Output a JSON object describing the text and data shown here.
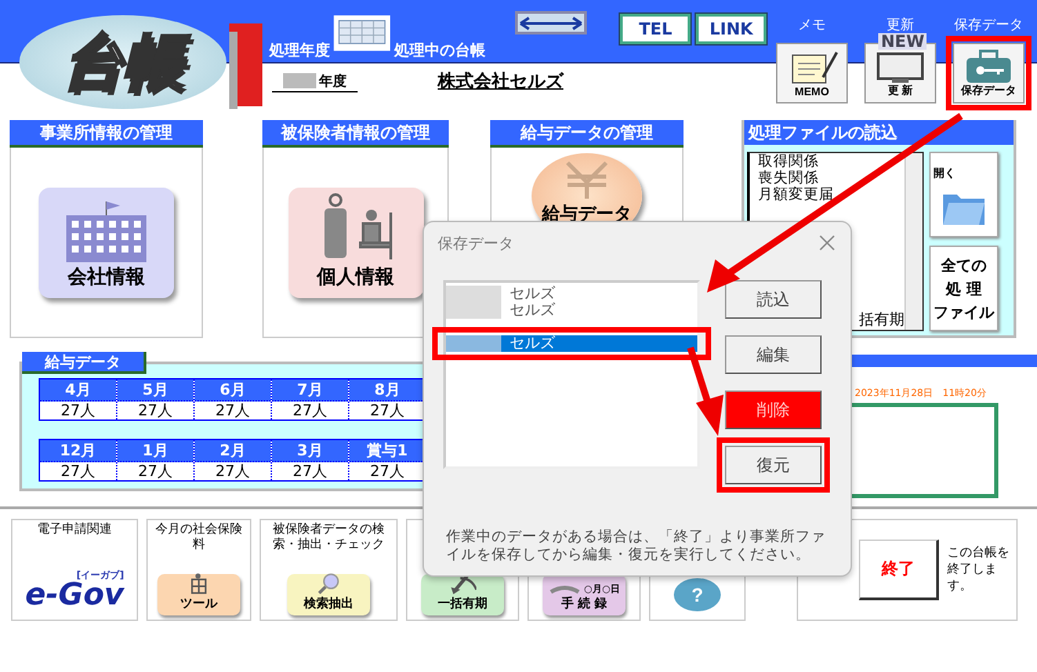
{
  "header": {
    "logo": "台帳",
    "year_label": "処理年度",
    "ledger_label": "処理中の台帳",
    "buttons": [
      "TEL",
      "LINK"
    ],
    "year_field": "年度",
    "company": "株式会社セルズ",
    "tools": [
      {
        "kind": "memo",
        "label": "メモ",
        "icon_text": "MEMO",
        "highlighted": false
      },
      {
        "kind": "update",
        "label": "更新",
        "badge": "NEW",
        "icon_text": "更 新",
        "highlighted": false
      },
      {
        "kind": "save",
        "label": "保存データ",
        "icon_text": "保存データ",
        "highlighted": true
      }
    ]
  },
  "panels": [
    {
      "kind": "company",
      "title": "事業所情報の管理",
      "button": "会社情報"
    },
    {
      "kind": "person",
      "title": "被保険者情報の管理",
      "button": "個人情報"
    },
    {
      "kind": "salary",
      "title": "給与データの管理",
      "button": "給与データ"
    }
  ],
  "file_panel": {
    "title": "処理ファイルの読込",
    "items": [
      "取得関係",
      "喪失関係",
      "月額変更届"
    ],
    "last_item": "括有期",
    "open": "開く",
    "all_files": [
      "全ての",
      "処 理",
      "ファイル"
    ]
  },
  "salary": {
    "title": "給与データ",
    "rows": [
      [
        {
          "month": "4月",
          "count": "27人"
        },
        {
          "month": "5月",
          "count": "27人"
        },
        {
          "month": "6月",
          "count": "27人"
        },
        {
          "month": "7月",
          "count": "27人"
        },
        {
          "month": "8月",
          "count": "27人"
        }
      ],
      [
        {
          "month": "12月",
          "count": "27人"
        },
        {
          "month": "1月",
          "count": "27人"
        },
        {
          "month": "2月",
          "count": "27人"
        },
        {
          "month": "3月",
          "count": "27人"
        },
        {
          "month": "賞与1",
          "count": "27人"
        }
      ]
    ]
  },
  "timestamp": "2023年11月28日　11時20分",
  "shortcuts": [
    {
      "kind": "egov",
      "title": "電子申請関連",
      "label": "e-Gov",
      "sub": "[イーガブ]"
    },
    {
      "kind": "tool",
      "title": "今月の社会保険料",
      "label": "ツール"
    },
    {
      "kind": "search",
      "title": "被保険者データの検索・抽出・チェック",
      "label": "検索抽出"
    },
    {
      "kind": "shovel",
      "label": "一括有期"
    },
    {
      "kind": "hand",
      "label": "手 続 録",
      "sub": "○月○日"
    },
    {
      "kind": "help",
      "label": "?"
    }
  ],
  "exit": {
    "button": "終了",
    "note": "この台帳を終了します。"
  },
  "dialog": {
    "title": "保存データ",
    "items": [
      {
        "label": "セルズ",
        "selected": false,
        "highlighted": false
      },
      {
        "label": "セルズ",
        "selected": false,
        "highlighted": false
      },
      {
        "label": "セルズ",
        "selected": true,
        "highlighted": true
      }
    ],
    "buttons": [
      {
        "label": "読込",
        "kind": "normal",
        "highlighted": false
      },
      {
        "label": "編集",
        "kind": "normal",
        "highlighted": false
      },
      {
        "label": "削除",
        "kind": "danger",
        "highlighted": false
      },
      {
        "label": "復元",
        "kind": "normal",
        "highlighted": true
      }
    ],
    "note": "作業中のデータがある場合は、「終了」より事業所ファイルを保存してから編集・復元を実行してください。"
  }
}
